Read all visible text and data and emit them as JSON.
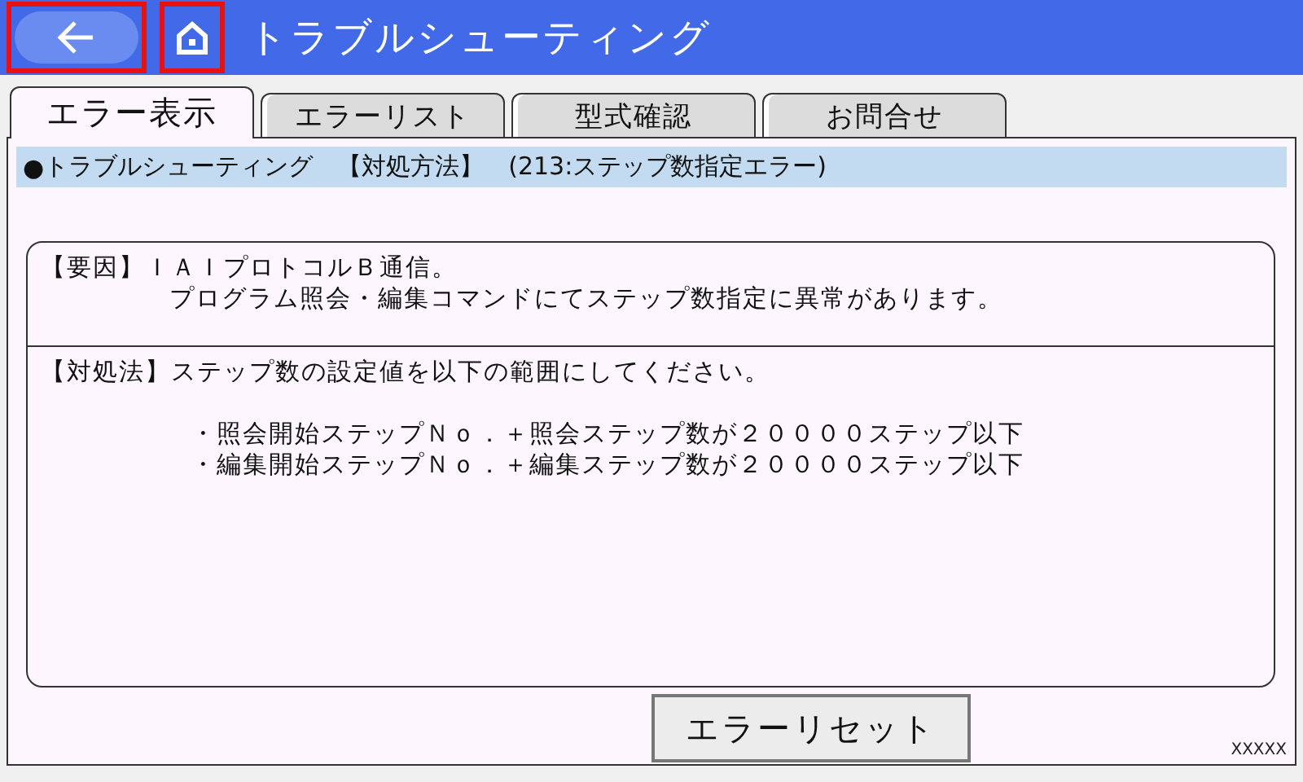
{
  "header": {
    "title": "トラブルシューティング"
  },
  "tabs": [
    {
      "label": "エラー表示",
      "selected": true
    },
    {
      "label": "エラーリスト",
      "selected": false
    },
    {
      "label": "型式確認",
      "selected": false
    },
    {
      "label": "お問合せ",
      "selected": false
    }
  ],
  "heading": {
    "bullet": "●",
    "text": "トラブルシューティング　【対処方法】　(213:ステップ数指定エラー)"
  },
  "cause": {
    "label": "【要因】",
    "lines": [
      "ＩＡＩプロトコルＢ通信。",
      "プログラム照会・編集コマンドにてステップ数指定に異常があります。"
    ]
  },
  "remedy": {
    "label": "【対処法】",
    "text": "ステップ数の設定値を以下の範囲にしてください。",
    "items": [
      "・照会開始ステップＮｏ．＋照会ステップ数が２００００ステップ以下",
      "・編集開始ステップＮｏ．＋編集ステップ数が２００００ステップ以下"
    ]
  },
  "reset_button": {
    "label": "エラーリセット"
  },
  "footer_code": "XXXXX"
}
